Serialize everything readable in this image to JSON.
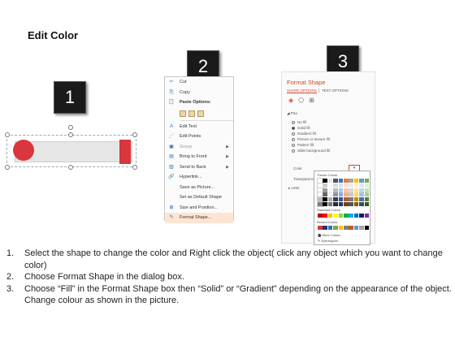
{
  "title": "Edit Color",
  "badges": [
    "1",
    "2",
    "3"
  ],
  "context_menu": {
    "items": [
      {
        "label": "Cut",
        "icon": "scissors-icon",
        "glyph": "✂"
      },
      {
        "label": "Copy",
        "icon": "copy-icon",
        "glyph": "⎘"
      },
      {
        "label": "Paste Options:",
        "icon": "paste-icon",
        "glyph": "📋"
      }
    ],
    "items2": [
      {
        "label": "Edit Text",
        "icon": "edit-text-icon",
        "glyph": "A"
      },
      {
        "label": "Edit Points",
        "icon": "edit-points-icon",
        "glyph": "⋰"
      },
      {
        "label": "Group",
        "icon": "group-icon",
        "glyph": "▣"
      },
      {
        "label": "Bring to Front",
        "icon": "bring-front-icon",
        "glyph": "▤"
      },
      {
        "label": "Send to Back",
        "icon": "send-back-icon",
        "glyph": "▥"
      },
      {
        "label": "Hyperlink...",
        "icon": "hyperlink-icon",
        "glyph": "🔗"
      },
      {
        "label": "Save as Picture...",
        "icon": "",
        "glyph": ""
      },
      {
        "label": "Set as Default Shape",
        "icon": "",
        "glyph": ""
      },
      {
        "label": "Size and Position...",
        "icon": "size-position-icon",
        "glyph": "⊞"
      },
      {
        "label": "Format Shape...",
        "icon": "format-shape-icon",
        "glyph": "✎"
      }
    ]
  },
  "format_pane": {
    "title": "Format Shape",
    "tab_active": "SHAPE OPTIONS",
    "tab_other": "TEXT OPTIONS",
    "fill_label": "◢ FILL",
    "fill_options": [
      "No fill",
      "Solid fill",
      "Gradient fill",
      "Picture or texture fill",
      "Pattern fill",
      "Slide background fill"
    ],
    "color_label": "Color",
    "transparency_label": "Transparency",
    "line_label": "▸ LINE",
    "palette": {
      "theme_label": "Theme Colors",
      "standard_label": "Standard Colors",
      "recent_label": "Recent Colors",
      "more_label": "More Colors...",
      "eyedropper_label": "Eyedropper"
    }
  },
  "colors": {
    "shape_red": "#d9363e",
    "accent": "#d24726"
  },
  "steps": [
    {
      "num": "1.",
      "text": "Select the shape to change the color and Right click the object( click any object which you want to change color)"
    },
    {
      "num": "2.",
      "text": "Choose Format Shape in the dialog box."
    },
    {
      "num": "3.",
      "text": "Choose “Fill” in the Format Shape box then “Solid” or “Gradient” depending on the appearance of the object. Change colour as shown in the picture."
    }
  ]
}
